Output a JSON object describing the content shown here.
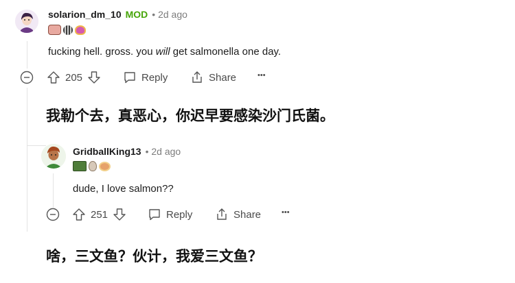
{
  "comments": [
    {
      "username": "solarion_dm_10",
      "badge": "MOD",
      "time": "• 2d ago",
      "text_before": "fucking hell. gross. you ",
      "text_em": "will",
      "text_after": " get salmonella one day.",
      "votes": "205",
      "reply": "Reply",
      "share": "Share",
      "more": "•••"
    },
    {
      "username": "GridballKing13",
      "time": "• 2d ago",
      "text": "dude, I love salmon??",
      "votes": "251",
      "reply": "Reply",
      "share": "Share",
      "more": "•••"
    }
  ],
  "captions": [
    "我勒个去，真恶心，你迟早要感染沙门氏菌。",
    "啥，三文鱼？伙计，我爱三文鱼？"
  ],
  "colors": {
    "mod": "#46a508",
    "meta": "#7c7c7c",
    "text": "#1a1a1b"
  }
}
